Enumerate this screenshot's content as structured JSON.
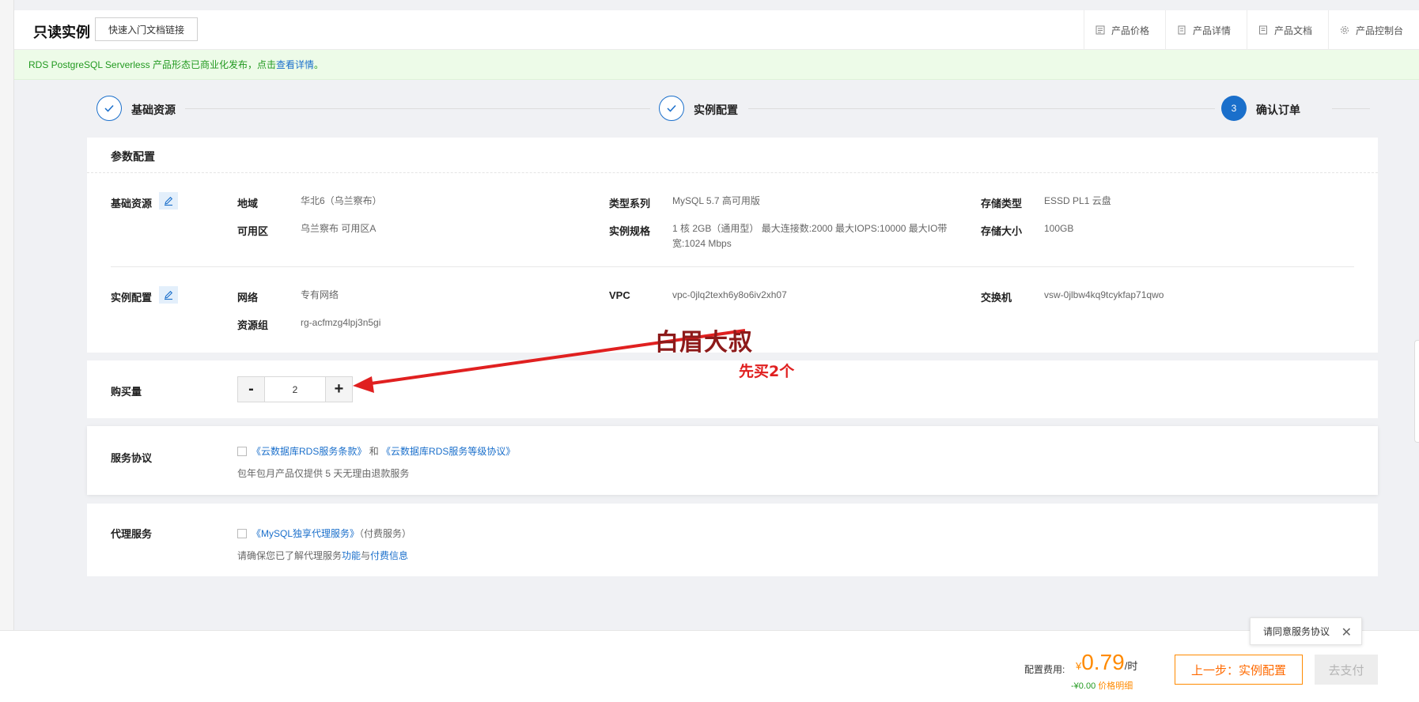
{
  "header": {
    "title": "只读实例",
    "quick_link": "快速入门文档链接",
    "links": [
      {
        "label": "产品价格",
        "icon": "price-list-icon"
      },
      {
        "label": "产品详情",
        "icon": "product-detail-icon"
      },
      {
        "label": "产品文档",
        "icon": "document-icon"
      },
      {
        "label": "产品控制台",
        "icon": "gear-icon"
      }
    ]
  },
  "notice": {
    "text": "RDS PostgreSQL Serverless 产品形态已商业化发布，点击",
    "link": "查看详情",
    "suffix": " 。"
  },
  "steps": [
    {
      "label": "基础资源",
      "state": "done"
    },
    {
      "label": "实例配置",
      "state": "done"
    },
    {
      "label": "确认订单",
      "state": "active",
      "number": "3"
    }
  ],
  "params": {
    "title": "参数配置",
    "basic": {
      "label": "基础资源",
      "region_label": "地域",
      "region_value": "华北6（乌兰察布）",
      "zone_label": "可用区",
      "zone_value": "乌兰察布 可用区A",
      "series_label": "类型系列",
      "series_value": "MySQL  5.7 高可用版",
      "spec_label": "实例规格",
      "spec_value": "1 核 2GB（通用型）   最大连接数:2000 最大IOPS:10000 最大IO带宽:1024 Mbps",
      "storage_type_label": "存储类型",
      "storage_type_value": "ESSD PL1 云盘",
      "storage_size_label": "存储大小",
      "storage_size_value": "100GB"
    },
    "instance": {
      "label": "实例配置",
      "network_label": "网络",
      "network_value": "专有网络",
      "rg_label": "资源组",
      "rg_value": "rg-acfmzg4lpj3n5gi",
      "vpc_label": "VPC",
      "vpc_value": "vpc-0jlq2texh6y8o6iv2xh07",
      "vsw_label": "交换机",
      "vsw_value": "vsw-0jlbw4kq9tcykfap71qwo"
    }
  },
  "quantity": {
    "label": "购买量",
    "minus": "-",
    "value": "2",
    "plus": "+"
  },
  "annotation": {
    "title": "白眉大叔",
    "text": "先买2个"
  },
  "agreement": {
    "label": "服务协议",
    "link1": "《云数据库RDS服务条款》",
    "and": "和",
    "link2": "《云数据库RDS服务等级协议》",
    "note": "包年包月产品仅提供 5 天无理由退款服务"
  },
  "proxy": {
    "label": "代理服务",
    "link": "《MySQL独享代理服务》",
    "paid": "（付费服务）",
    "note_prefix": "请确保您已了解代理服务",
    "note_link1": "功能",
    "note_and": "与",
    "note_link2": "付费信息"
  },
  "footer": {
    "fee_label": "配置费用:",
    "currency": "¥",
    "price": "0.79",
    "unit": "/时",
    "discount": "-¥0.00",
    "detail_link": "价格明细",
    "prev_button": "上一步：实例配置",
    "pay_button": "去支付",
    "tooltip": "请同意服务协议",
    "tooltip_close": "✕"
  },
  "colors": {
    "accent": "#1a6fcb",
    "price": "#ff8a00",
    "success": "#21991f",
    "annotation_arrow": "#e02020"
  }
}
